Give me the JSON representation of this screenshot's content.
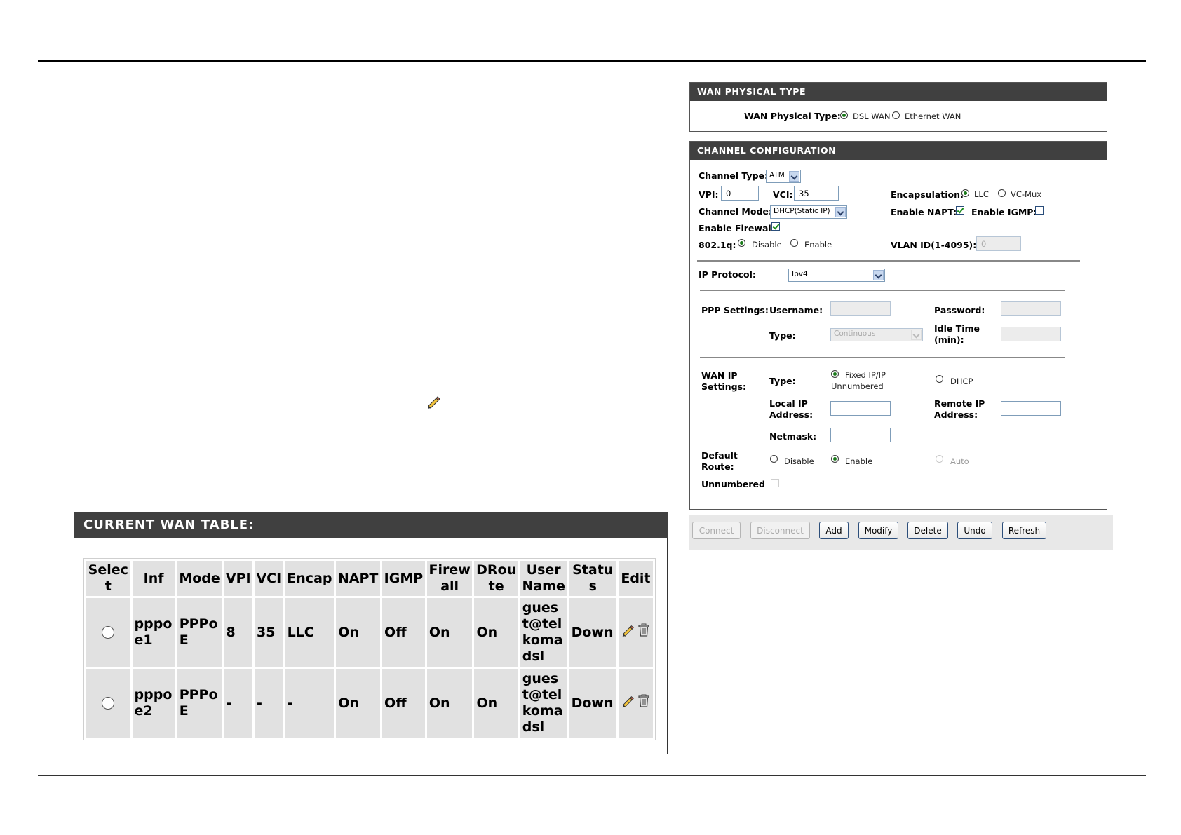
{
  "wan_physical": {
    "title": "WAN PHYSICAL TYPE",
    "label": "WAN Physical Type:",
    "options": [
      "DSL WAN",
      "Ethernet WAN"
    ],
    "selected": "DSL WAN"
  },
  "channel": {
    "title": "CHANNEL CONFIGURATION",
    "channel_type_label": "Channel Type:",
    "channel_type_value": "ATM",
    "vpi_label": "VPI:",
    "vpi_value": "0",
    "vci_label": "VCI:",
    "vci_value": "35",
    "encap_label": "Encapsulation:",
    "encap_options": [
      "LLC",
      "VC-Mux"
    ],
    "encap_selected": "LLC",
    "channel_mode_label": "Channel Mode:",
    "channel_mode_value": "DHCP(Static IP)",
    "napt_label": "Enable NAPT:",
    "napt_checked": true,
    "igmp_label": "Enable IGMP:",
    "igmp_checked": false,
    "firewall_label": "Enable Firewall:",
    "firewall_checked": true,
    "dot1q_label": "802.1q:",
    "dot1q_options": [
      "Disable",
      "Enable"
    ],
    "dot1q_selected": "Disable",
    "vlan_label": "VLAN ID(1-4095):",
    "vlan_value": "0",
    "ip_protocol_label": "IP Protocol:",
    "ip_protocol_value": "Ipv4",
    "ppp": {
      "section_label": "PPP Settings:",
      "username_label": "Username:",
      "password_label": "Password:",
      "type_label": "Type:",
      "type_value": "Continuous",
      "idle_label_1": "Idle Time",
      "idle_label_2": "(min):"
    },
    "wanip": {
      "section_label_1": "WAN IP",
      "section_label_2": "Settings:",
      "type_label": "Type:",
      "type_fixed_1": "Fixed IP/IP",
      "type_fixed_2": "Unnumbered",
      "type_dhcp": "DHCP",
      "type_selected": "Fixed IP/IP Unnumbered",
      "local_ip_1": "Local IP",
      "local_ip_2": "Address:",
      "remote_ip_1": "Remote IP",
      "remote_ip_2": "Address:",
      "netmask_label": "Netmask:",
      "default_route_1": "Default",
      "default_route_2": "Route:",
      "route_options": [
        "Disable",
        "Enable",
        "Auto"
      ],
      "route_selected": "Enable",
      "unnumbered_label": "Unnumbered",
      "unnumbered_checked": false
    }
  },
  "buttons": {
    "connect": "Connect",
    "disconnect": "Disconnect",
    "add": "Add",
    "modify": "Modify",
    "delete": "Delete",
    "undo": "Undo",
    "refresh": "Refresh"
  },
  "wan_table": {
    "title": "CURRENT WAN TABLE:",
    "headers": [
      [
        "Selec",
        "t"
      ],
      [
        "Inf"
      ],
      [
        "Mode"
      ],
      [
        "VPI"
      ],
      [
        "VCI"
      ],
      [
        "Encap"
      ],
      [
        "NAPT"
      ],
      [
        "IGMP"
      ],
      [
        "Firew",
        "all"
      ],
      [
        "DRou",
        "te"
      ],
      [
        "User",
        "Name"
      ],
      [
        "Statu",
        "s"
      ],
      [
        "Edit"
      ]
    ],
    "rows": [
      {
        "inf": [
          "pppo",
          "e1"
        ],
        "mode": [
          "PPPo",
          "E"
        ],
        "vpi": "8",
        "vci": "35",
        "encap": "LLC",
        "napt": "On",
        "igmp": "Off",
        "firewall": "On",
        "droute": "On",
        "username": [
          "gues",
          "t@tel",
          "koma",
          "dsl"
        ],
        "status": "Down"
      },
      {
        "inf": [
          "pppo",
          "e2"
        ],
        "mode": [
          "PPPo",
          "E"
        ],
        "vpi": "-",
        "vci": "-",
        "encap": "-",
        "napt": "On",
        "igmp": "Off",
        "firewall": "On",
        "droute": "On",
        "username": [
          "gues",
          "t@tel",
          "koma",
          "dsl"
        ],
        "status": "Down"
      }
    ]
  },
  "colors": {
    "section_header_bg": "#404040",
    "cell_bg": "#e1e1e1",
    "check_green": "#1a8a1a"
  },
  "icons": [
    "pencil-icon",
    "trash-icon",
    "dropdown-arrow-icon"
  ]
}
